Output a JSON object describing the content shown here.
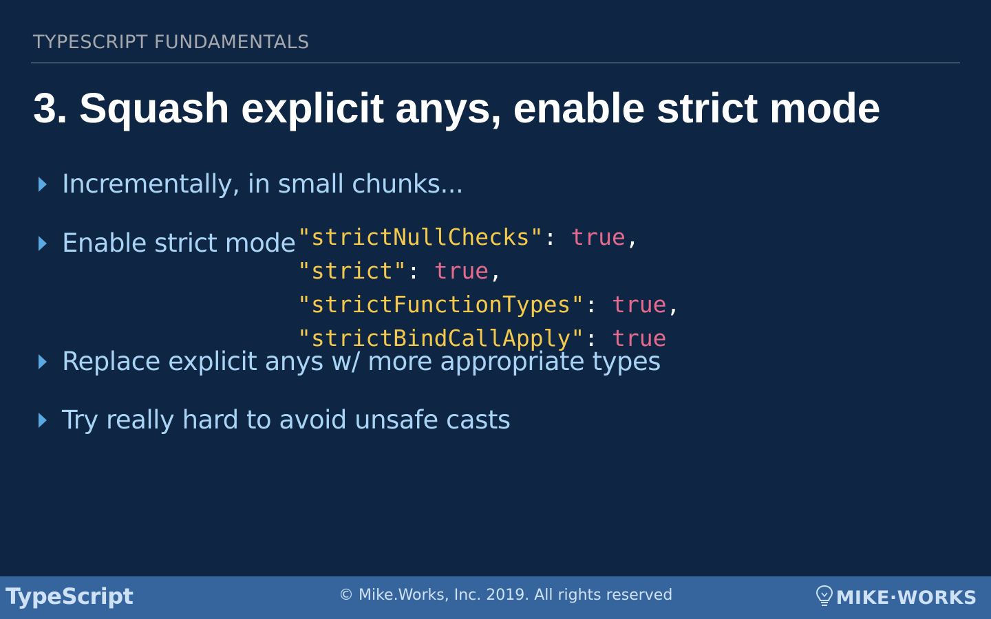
{
  "header": {
    "section_label": "TYPESCRIPT FUNDAMENTALS",
    "title": "3. Squash explicit anys, enable strict mode"
  },
  "bullets": [
    {
      "text": "Incrementally, in small chunks..."
    },
    {
      "text": "Enable strict mode"
    },
    {
      "text": "Replace explicit anys w/ more appropriate types"
    },
    {
      "text": "Try really hard to avoid unsafe casts"
    }
  ],
  "code": {
    "lines": [
      {
        "key": "\"strictNullChecks\"",
        "sep": ": ",
        "value": "true",
        "trail": ","
      },
      {
        "key": "\"strict\"",
        "sep": ": ",
        "value": "true",
        "trail": ","
      },
      {
        "key": "\"strictFunctionTypes\"",
        "sep": ": ",
        "value": "true",
        "trail": ","
      },
      {
        "key": "\"strictBindCallApply\"",
        "sep": ": ",
        "value": "true",
        "trail": ""
      }
    ]
  },
  "footer": {
    "left_logo": "TypeScript",
    "copyright": "© Mike.Works, Inc. 2019. All rights reserved",
    "right_logo": "MIKE·WORKS",
    "right_icon": "lightbulb-icon"
  },
  "colors": {
    "background": "#0e2643",
    "footer": "#36659e",
    "bullet_text": "#a9d4f5",
    "bullet_arrow": "#5aa9e3",
    "code_key": "#f5c94c",
    "code_value": "#e66a8e"
  }
}
